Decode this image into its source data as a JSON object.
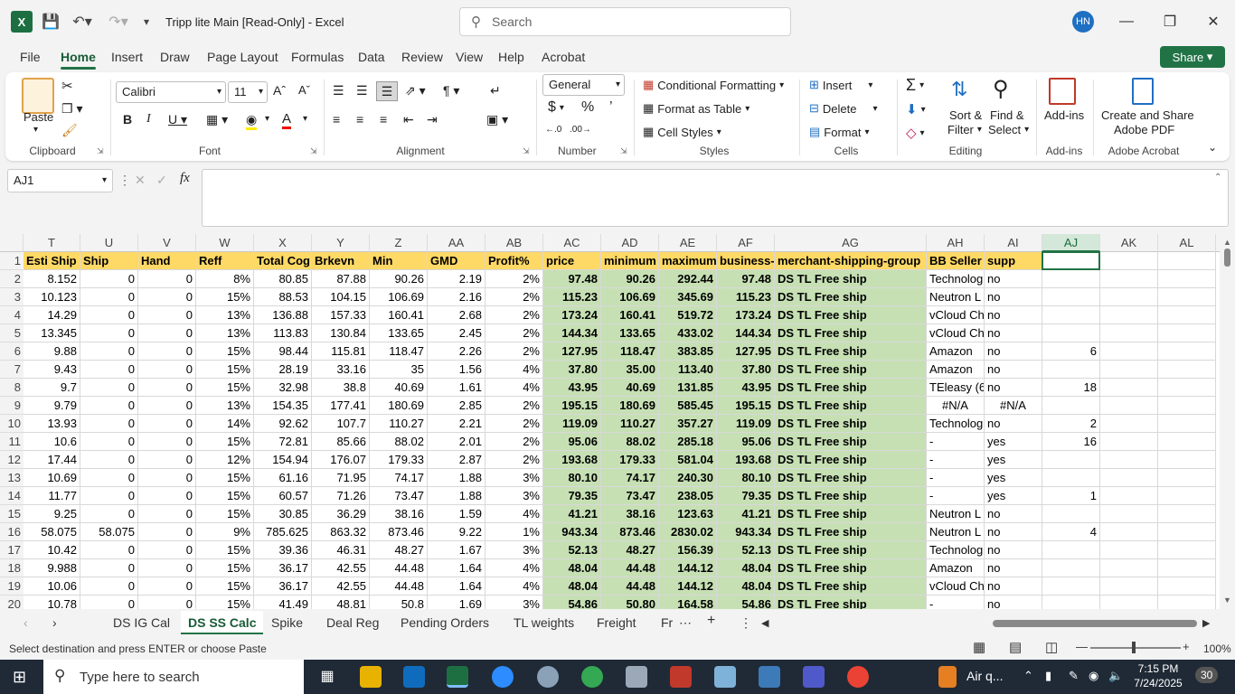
{
  "app": {
    "title": "Tripp lite Main  [Read-Only]  -  Excel",
    "search_placeholder": "Search",
    "user_initials": "HN"
  },
  "menu": {
    "tabs": [
      "File",
      "Home",
      "Insert",
      "Draw",
      "Page Layout",
      "Formulas",
      "Data",
      "Review",
      "View",
      "Help",
      "Acrobat"
    ],
    "share": "Share"
  },
  "ribbon": {
    "clipboard": {
      "paste": "Paste",
      "label": "Clipboard"
    },
    "font": {
      "name": "Calibri",
      "size": "11",
      "label": "Font"
    },
    "alignment": {
      "label": "Alignment"
    },
    "number": {
      "format": "General",
      "label": "Number"
    },
    "styles": {
      "cond": "Conditional Formatting",
      "table": "Format as Table",
      "cell": "Cell Styles",
      "label": "Styles"
    },
    "cells": {
      "insert": "Insert",
      "delete": "Delete",
      "format": "Format",
      "label": "Cells"
    },
    "editing": {
      "sort1": "Sort &",
      "sort2": "Filter",
      "find1": "Find &",
      "find2": "Select",
      "label": "Editing"
    },
    "addins": {
      "btn": "Add-ins",
      "label": "Add-ins"
    },
    "acrobat": {
      "btn1": "Create and Share",
      "btn2": "Adobe PDF",
      "label": "Adobe Acrobat"
    }
  },
  "formula_bar": {
    "name_box": "AJ1",
    "fx": "fx",
    "formula": ""
  },
  "grid": {
    "columns": [
      "T",
      "U",
      "V",
      "W",
      "X",
      "Y",
      "Z",
      "AA",
      "AB",
      "AC",
      "AD",
      "AE",
      "AF",
      "AG",
      "AH",
      "AI",
      "AJ",
      "AK",
      "AL"
    ],
    "selected_column": "AJ",
    "header_row": [
      "Esti Ship",
      "Ship",
      "Hand",
      "Reff",
      "Total Cog",
      "Brkevn",
      "Min",
      "GMD",
      "Profit%",
      "price",
      "minimum",
      "maximum",
      "business-",
      "merchant-shipping-group",
      "BB Seller",
      "supp",
      "",
      "",
      ""
    ],
    "rows": [
      [
        "8.152",
        "0",
        "0",
        "8%",
        "80.85",
        "87.88",
        "90.26",
        "2.19",
        "2%",
        "97.48",
        "90.26",
        "292.44",
        "97.48",
        "DS TL Free ship",
        "Technolog",
        "no",
        "",
        "",
        ""
      ],
      [
        "10.123",
        "0",
        "0",
        "15%",
        "88.53",
        "104.15",
        "106.69",
        "2.16",
        "2%",
        "115.23",
        "106.69",
        "345.69",
        "115.23",
        "DS TL Free ship",
        "Neutron L",
        "no",
        "",
        "",
        ""
      ],
      [
        "14.29",
        "0",
        "0",
        "13%",
        "136.88",
        "157.33",
        "160.41",
        "2.68",
        "2%",
        "173.24",
        "160.41",
        "519.72",
        "173.24",
        "DS TL Free ship",
        "vCloud Ch",
        "no",
        "",
        "",
        ""
      ],
      [
        "13.345",
        "0",
        "0",
        "13%",
        "113.83",
        "130.84",
        "133.65",
        "2.45",
        "2%",
        "144.34",
        "133.65",
        "433.02",
        "144.34",
        "DS TL Free ship",
        "vCloud Ch",
        "no",
        "",
        "",
        ""
      ],
      [
        "9.88",
        "0",
        "0",
        "15%",
        "98.44",
        "115.81",
        "118.47",
        "2.26",
        "2%",
        "127.95",
        "118.47",
        "383.85",
        "127.95",
        "DS TL Free ship",
        "Amazon",
        "no",
        "6",
        "",
        ""
      ],
      [
        "9.43",
        "0",
        "0",
        "15%",
        "28.19",
        "33.16",
        "35",
        "1.56",
        "4%",
        "37.80",
        "35.00",
        "113.40",
        "37.80",
        "DS TL Free ship",
        "Amazon",
        "no",
        "",
        "",
        ""
      ],
      [
        "9.7",
        "0",
        "0",
        "15%",
        "32.98",
        "38.8",
        "40.69",
        "1.61",
        "4%",
        "43.95",
        "40.69",
        "131.85",
        "43.95",
        "DS TL Free ship",
        "TEleasy (6",
        "no",
        "18",
        "",
        ""
      ],
      [
        "9.79",
        "0",
        "0",
        "13%",
        "154.35",
        "177.41",
        "180.69",
        "2.85",
        "2%",
        "195.15",
        "180.69",
        "585.45",
        "195.15",
        "DS TL Free ship",
        "#N/A",
        "#N/A",
        "",
        "",
        ""
      ],
      [
        "13.93",
        "0",
        "0",
        "14%",
        "92.62",
        "107.7",
        "110.27",
        "2.21",
        "2%",
        "119.09",
        "110.27",
        "357.27",
        "119.09",
        "DS TL Free ship",
        "Technolog",
        "no",
        "2",
        "",
        ""
      ],
      [
        "10.6",
        "0",
        "0",
        "15%",
        "72.81",
        "85.66",
        "88.02",
        "2.01",
        "2%",
        "95.06",
        "88.02",
        "285.18",
        "95.06",
        "DS TL Free ship",
        "-",
        "yes",
        "16",
        "",
        ""
      ],
      [
        "17.44",
        "0",
        "0",
        "12%",
        "154.94",
        "176.07",
        "179.33",
        "2.87",
        "2%",
        "193.68",
        "179.33",
        "581.04",
        "193.68",
        "DS TL Free ship",
        "-",
        "yes",
        "",
        "",
        ""
      ],
      [
        "10.69",
        "0",
        "0",
        "15%",
        "61.16",
        "71.95",
        "74.17",
        "1.88",
        "3%",
        "80.10",
        "74.17",
        "240.30",
        "80.10",
        "DS TL Free ship",
        "-",
        "yes",
        "",
        "",
        ""
      ],
      [
        "11.77",
        "0",
        "0",
        "15%",
        "60.57",
        "71.26",
        "73.47",
        "1.88",
        "3%",
        "79.35",
        "73.47",
        "238.05",
        "79.35",
        "DS TL Free ship",
        "-",
        "yes",
        "1",
        "",
        ""
      ],
      [
        "9.25",
        "0",
        "0",
        "15%",
        "30.85",
        "36.29",
        "38.16",
        "1.59",
        "4%",
        "41.21",
        "38.16",
        "123.63",
        "41.21",
        "DS TL Free ship",
        "Neutron L",
        "no",
        "",
        "",
        ""
      ],
      [
        "58.075",
        "58.075",
        "0",
        "9%",
        "785.625",
        "863.32",
        "873.46",
        "9.22",
        "1%",
        "943.34",
        "873.46",
        "2830.02",
        "943.34",
        "DS TL Free ship",
        "Neutron L",
        "no",
        "4",
        "",
        ""
      ],
      [
        "10.42",
        "0",
        "0",
        "15%",
        "39.36",
        "46.31",
        "48.27",
        "1.67",
        "3%",
        "52.13",
        "48.27",
        "156.39",
        "52.13",
        "DS TL Free ship",
        "Technolog",
        "no",
        "",
        "",
        ""
      ],
      [
        "9.988",
        "0",
        "0",
        "15%",
        "36.17",
        "42.55",
        "44.48",
        "1.64",
        "4%",
        "48.04",
        "44.48",
        "144.12",
        "48.04",
        "DS TL Free ship",
        "Amazon",
        "no",
        "",
        "",
        ""
      ],
      [
        "10.06",
        "0",
        "0",
        "15%",
        "36.17",
        "42.55",
        "44.48",
        "1.64",
        "4%",
        "48.04",
        "44.48",
        "144.12",
        "48.04",
        "DS TL Free ship",
        "vCloud Ch",
        "no",
        "",
        "",
        ""
      ],
      [
        "10.78",
        "0",
        "0",
        "15%",
        "41.49",
        "48.81",
        "50.8",
        "1.69",
        "3%",
        "54.86",
        "50.80",
        "164.58",
        "54.86",
        "DS TL Free ship",
        "-",
        "no",
        "",
        "",
        ""
      ]
    ]
  },
  "sheet_tabs": [
    "DS IG Cal",
    "DS SS Calc",
    "Spike",
    "Deal Reg",
    "Pending Orders",
    "TL weights",
    "Freight",
    "Fr"
  ],
  "active_sheet": "DS SS Calc",
  "status": {
    "message": "Select destination and press ENTER or choose Paste",
    "zoom": "100%"
  },
  "taskbar": {
    "search": "Type here to search",
    "weather": "Air q...",
    "time": "7:15 PM",
    "date": "7/24/2025",
    "notifications": "30"
  }
}
